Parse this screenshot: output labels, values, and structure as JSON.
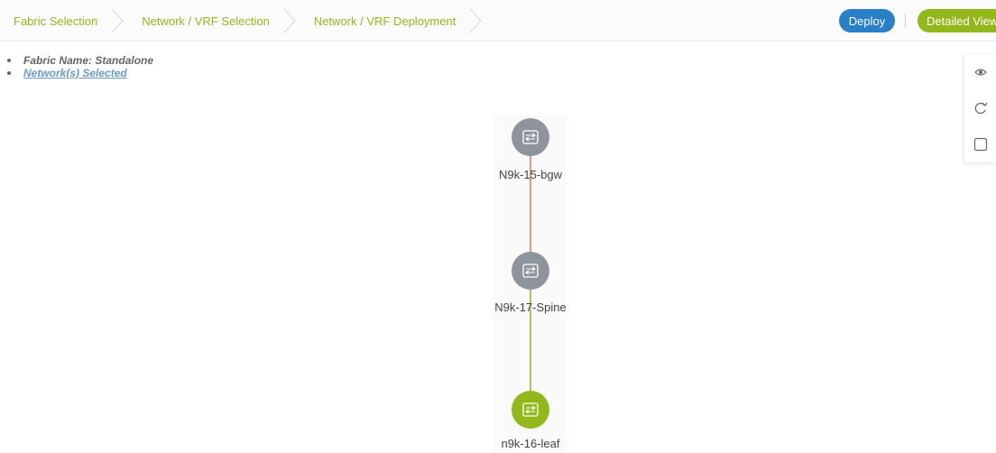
{
  "wizard": {
    "steps": [
      {
        "label": "Fabric Selection"
      },
      {
        "label": "Network / VRF Selection"
      },
      {
        "label": "Network / VRF Deployment"
      }
    ],
    "deploy_label": "Deploy",
    "detailed_view_label": "Detailed View"
  },
  "info": {
    "fabric_name": "Fabric Name: Standalone",
    "networks_selected": "Network(s) Selected"
  },
  "tools": [
    {
      "icon": "eye-icon"
    },
    {
      "icon": "refresh-icon"
    },
    {
      "icon": "square-icon"
    }
  ],
  "topology": {
    "nodes": [
      {
        "name": "N9k-15-bgw",
        "color": "#8e949c"
      },
      {
        "name": "N9k-17-Spine",
        "color": "#8e949c"
      },
      {
        "name": "n9k-16-leaf",
        "color": "#93b81b"
      }
    ],
    "links": [
      {
        "from": "N9k-15-bgw",
        "to": "N9k-17-Spine",
        "color": "#e8744f"
      },
      {
        "from": "N9k-17-Spine",
        "to": "n9k-16-leaf",
        "color": "#93b81b"
      }
    ]
  },
  "colors": {
    "accent_green": "#93b81b",
    "deploy_blue": "#2a7fc9",
    "link_blue": "#6a98c8"
  }
}
